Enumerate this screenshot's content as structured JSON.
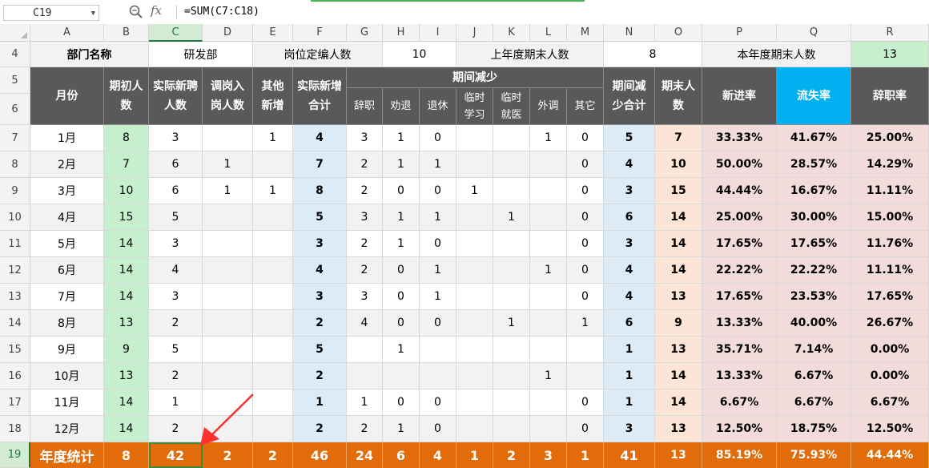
{
  "formula_bar": {
    "name_box": "C19",
    "fx_label": "fx",
    "formula": "=SUM(C7:C18)"
  },
  "columns": [
    "A",
    "B",
    "C",
    "D",
    "E",
    "F",
    "G",
    "H",
    "I",
    "J",
    "K",
    "L",
    "M",
    "N",
    "O",
    "P",
    "Q",
    "R"
  ],
  "rows": [
    "4",
    "5",
    "6",
    "7",
    "8",
    "9",
    "10",
    "11",
    "12",
    "13",
    "14",
    "15",
    "16",
    "17",
    "18",
    "19"
  ],
  "row4": {
    "dept_label": "部门名称",
    "dept_value": "研发部",
    "quota_label": "岗位定编人数",
    "quota_value": "10",
    "prev_label": "上年度期末人数",
    "prev_value": "8",
    "curr_label": "本年度期末人数",
    "curr_value": "13"
  },
  "headers": {
    "month": "月份",
    "begin": "期初人数",
    "hire": "实际新聘人数",
    "transfer_in": "调岗入岗人数",
    "other_add": "其他新增",
    "add_total": "实际新增合计",
    "decrease_group": "期间减少",
    "resign": "辞职",
    "dismiss": "劝退",
    "retire": "退休",
    "temp_study": "临时学习",
    "temp_medical": "临时就医",
    "transfer_out": "外调",
    "other": "其它",
    "decrease_total": "期间减少合计",
    "end": "期末人数",
    "new_rate": "新进率",
    "loss_rate": "流失率",
    "resign_rate": "辞职率"
  },
  "table_rows": [
    [
      "1月",
      "8",
      "3",
      "",
      "1",
      "4",
      "3",
      "1",
      "0",
      "",
      "",
      "1",
      "0",
      "5",
      "7",
      "33.33%",
      "41.67%",
      "25.00%"
    ],
    [
      "2月",
      "7",
      "6",
      "1",
      "",
      "7",
      "2",
      "1",
      "1",
      "",
      "",
      "",
      "0",
      "4",
      "10",
      "50.00%",
      "28.57%",
      "14.29%"
    ],
    [
      "3月",
      "10",
      "6",
      "1",
      "1",
      "8",
      "2",
      "0",
      "0",
      "1",
      "",
      "",
      "0",
      "3",
      "15",
      "44.44%",
      "16.67%",
      "11.11%"
    ],
    [
      "4月",
      "15",
      "5",
      "",
      "",
      "5",
      "3",
      "1",
      "1",
      "",
      "1",
      "",
      "0",
      "6",
      "14",
      "25.00%",
      "30.00%",
      "15.00%"
    ],
    [
      "5月",
      "14",
      "3",
      "",
      "",
      "3",
      "2",
      "1",
      "0",
      "",
      "",
      "",
      "0",
      "3",
      "14",
      "17.65%",
      "17.65%",
      "11.76%"
    ],
    [
      "6月",
      "14",
      "4",
      "",
      "",
      "4",
      "2",
      "0",
      "1",
      "",
      "",
      "1",
      "0",
      "4",
      "14",
      "22.22%",
      "22.22%",
      "11.11%"
    ],
    [
      "7月",
      "14",
      "3",
      "",
      "",
      "3",
      "3",
      "0",
      "1",
      "",
      "",
      "",
      "0",
      "4",
      "13",
      "17.65%",
      "23.53%",
      "17.65%"
    ],
    [
      "8月",
      "13",
      "2",
      "",
      "",
      "2",
      "4",
      "0",
      "0",
      "",
      "1",
      "",
      "1",
      "6",
      "9",
      "13.33%",
      "40.00%",
      "26.67%"
    ],
    [
      "9月",
      "9",
      "5",
      "",
      "",
      "5",
      "",
      "1",
      "",
      "",
      "",
      "",
      "",
      "1",
      "13",
      "35.71%",
      "7.14%",
      "0.00%"
    ],
    [
      "10月",
      "13",
      "2",
      "",
      "",
      "2",
      "",
      "",
      "",
      "",
      "",
      "1",
      "",
      "1",
      "14",
      "13.33%",
      "6.67%",
      "0.00%"
    ],
    [
      "11月",
      "14",
      "1",
      "",
      "",
      "1",
      "1",
      "0",
      "0",
      "",
      "",
      "",
      "0",
      "1",
      "14",
      "6.67%",
      "6.67%",
      "6.67%"
    ],
    [
      "12月",
      "14",
      "2",
      "",
      "",
      "2",
      "2",
      "1",
      "0",
      "",
      "",
      "",
      "0",
      "3",
      "13",
      "12.50%",
      "18.75%",
      "12.50%"
    ]
  ],
  "totals": [
    "年度统计",
    "8",
    "42",
    "2",
    "2",
    "46",
    "24",
    "6",
    "4",
    "1",
    "2",
    "3",
    "1",
    "41",
    "13",
    "85.19%",
    "75.93%",
    "44.44%"
  ],
  "colors": {
    "header_dark": "#595959",
    "header_blue": "#00b0f0",
    "begin_col": "#c6efce",
    "add_total_col": "#ddebf7",
    "decrease_total_col": "#ddebf7",
    "end_col": "#fce4d6",
    "rate_cols": "#f2dcdb",
    "total_row": "#e26b0a",
    "stripe": "#f2f2f2",
    "arrow": "#ff3030"
  },
  "icons": [
    "name-box-dropdown-icon",
    "zoom-icon",
    "red-arrow-icon"
  ]
}
